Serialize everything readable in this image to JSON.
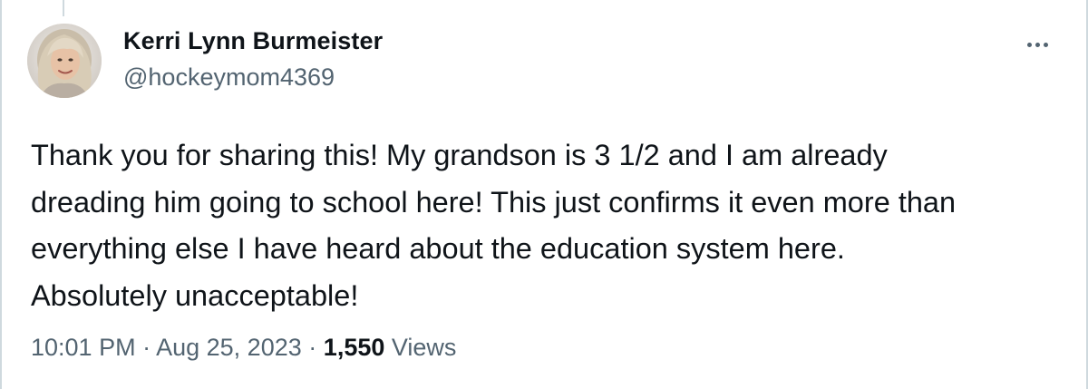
{
  "author": {
    "display_name": "Kerri Lynn Burmeister",
    "handle": "@hockeymom4369"
  },
  "post": {
    "lines": [
      "Thank you for sharing this! My grandson is 3 1/2 and I am already",
      "dreading him going to school here! This just confirms it even more than",
      "everything else I have heard about the education system here.",
      "Absolutely unacceptable!"
    ]
  },
  "meta": {
    "time": "10:01 PM",
    "separator": "·",
    "date": "Aug 25, 2023",
    "view_count": "1,550",
    "views_label": "Views"
  },
  "icons": {
    "more": "more-horizontal-icon"
  },
  "colors": {
    "text_primary": "#0f1419",
    "text_secondary": "#536471",
    "border": "#cfd9de",
    "background": "#ffffff"
  }
}
